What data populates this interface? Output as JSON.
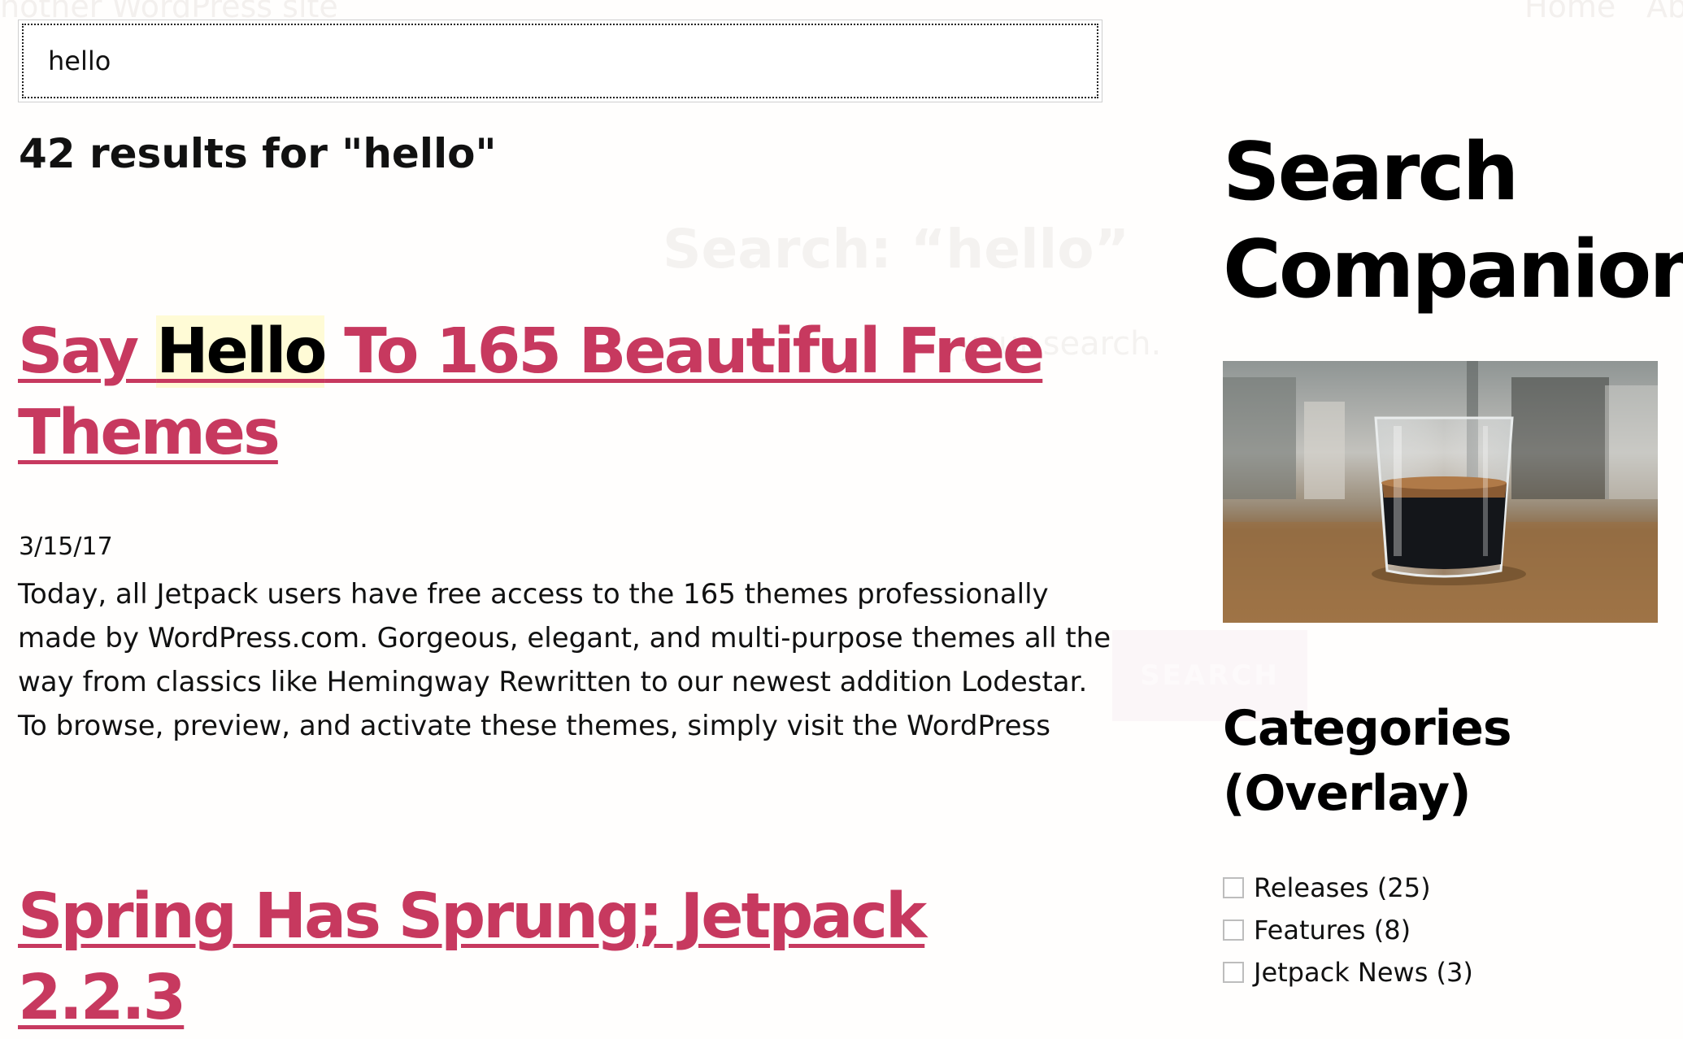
{
  "background_site": {
    "site_name": "nother WordPress site",
    "nav": [
      "Home",
      "Ab"
    ],
    "heading": "Search: “hello”",
    "subtext": "your search.",
    "button_label": "SEARCH"
  },
  "search": {
    "value": "hello",
    "placeholder": ""
  },
  "results": {
    "count_text": "42 results for \"hello\"",
    "items": [
      {
        "title_pre": "Say ",
        "title_highlight": "Hello",
        "title_post": " To 165 Beautiful Free Themes",
        "date": "3/15/17",
        "excerpt": "Today, all Jetpack users have free access to the 165 themes professionally made by WordPress.com. Gorgeous, elegant, and multi-purpose themes all the way from classics like Hemingway Rewritten to our newest addition Lodestar. To browse, preview, and activate these themes, simply visit the WordPress"
      },
      {
        "title": "Spring Has Sprung; Jetpack 2.2.3"
      }
    ]
  },
  "sidebar": {
    "title": "Search Companion",
    "image_icon": "espresso-glass-photo",
    "categories_title": "Categories (Overlay)",
    "categories": [
      {
        "label": "Releases (25)",
        "checked": false
      },
      {
        "label": "Features (8)",
        "checked": false
      },
      {
        "label": "Jetpack News (3)",
        "checked": false
      }
    ]
  },
  "colors": {
    "link": "#c7395f",
    "highlight": "#fffbd6",
    "text": "#111111"
  }
}
